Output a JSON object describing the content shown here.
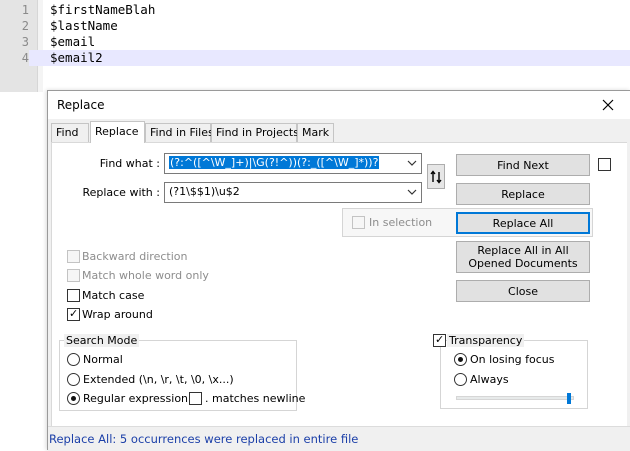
{
  "editor": {
    "lines": [
      {
        "number": "1",
        "text": "$firstNameBlah"
      },
      {
        "number": "2",
        "text": "$lastName"
      },
      {
        "number": "3",
        "text": "$email"
      },
      {
        "number": "4",
        "text": "$email2"
      }
    ]
  },
  "dialog": {
    "title": "Replace",
    "close_icon": "close-icon",
    "tabs": [
      {
        "label": "Find",
        "active": false
      },
      {
        "label": "Replace",
        "active": true
      },
      {
        "label": "Find in Files",
        "active": false
      },
      {
        "label": "Find in Projects",
        "active": false
      },
      {
        "label": "Mark",
        "active": false
      }
    ],
    "find_what": {
      "label": "Find what :",
      "value": "(?:^([^\\W_]+)|\\G(?!^))(?:_([^\\W_]*))?"
    },
    "replace_with": {
      "label": "Replace with :",
      "value": "(?1\\$$1)\\u$2"
    },
    "swap_icon": "swap-arrows-icon",
    "buttons": {
      "find_next": "Find Next",
      "replace": "Replace",
      "replace_all": "Replace All",
      "replace_all_opened": "Replace All in All Opened Documents",
      "close": "Close"
    },
    "in_selection": {
      "label": "In selection",
      "checked": false,
      "enabled": false
    },
    "options": {
      "backward_direction": {
        "label": "Backward direction",
        "checked": false,
        "enabled": false
      },
      "match_whole_word": {
        "label": "Match whole word only",
        "checked": false,
        "enabled": false
      },
      "match_case": {
        "label": "Match case",
        "checked": false,
        "enabled": true
      },
      "wrap_around": {
        "label": "Wrap around",
        "checked": true,
        "enabled": true
      }
    },
    "search_mode": {
      "title": "Search Mode",
      "normal": {
        "label": "Normal",
        "selected": false
      },
      "extended": {
        "label": "Extended (\\n, \\r, \\t, \\0, \\x...)",
        "selected": false
      },
      "regex": {
        "label": "Regular expression",
        "selected": true
      },
      "matches_newline": {
        "label": ". matches newline",
        "checked": false
      }
    },
    "transparency": {
      "label": "Transparency",
      "checked": true,
      "on_losing_focus": {
        "label": "On losing focus",
        "selected": true
      },
      "always": {
        "label": "Always",
        "selected": false
      },
      "level": 0.97
    },
    "status": "Replace All: 5 occurrences were replaced in entire file"
  },
  "colors": {
    "selection": "#0078d7",
    "status_text": "#1b3fa8",
    "current_line": "#e8e8ff"
  }
}
